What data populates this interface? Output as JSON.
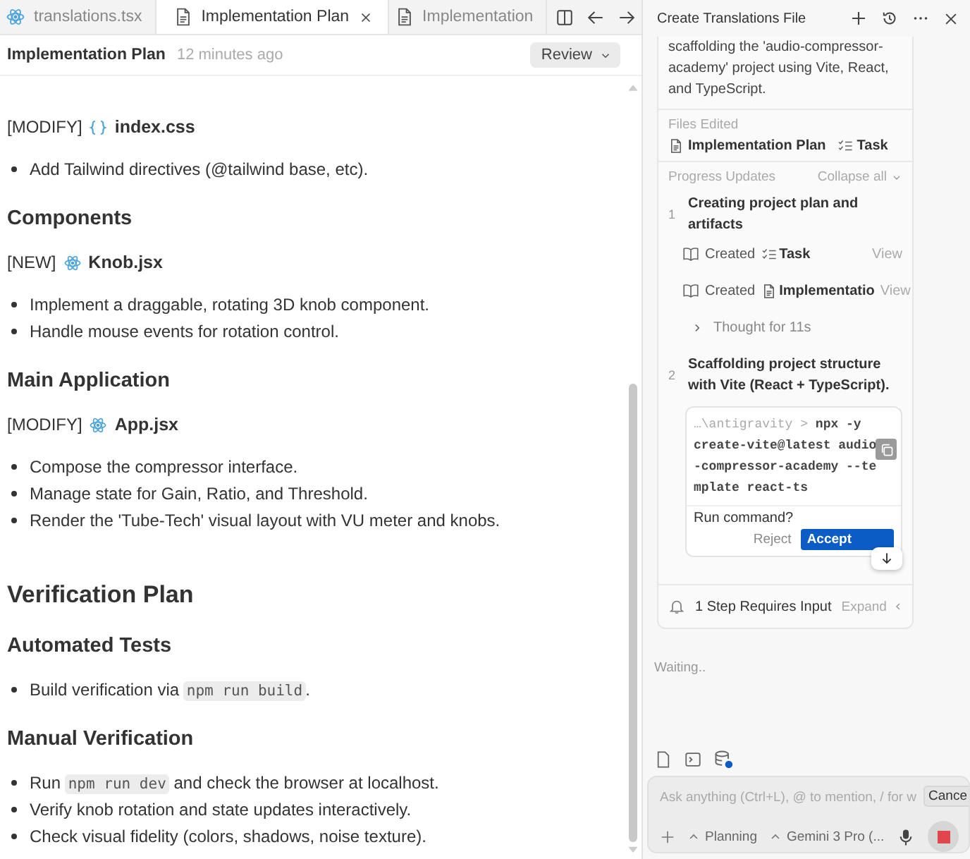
{
  "tabs": [
    {
      "label": "translations.tsx",
      "kind": "component",
      "selected": false
    },
    {
      "label": "Implementation Plan",
      "kind": "document",
      "selected": true
    },
    {
      "label": "Implementation",
      "kind": "document",
      "selected": false
    }
  ],
  "document": {
    "title": "Implementation Plan",
    "time": "12 minutes ago",
    "review_button": "Review",
    "blocks": [
      {
        "kind": "stylesheet",
        "tag": "[MODIFY]",
        "name": "index.css"
      },
      {
        "kind": "bullets",
        "items": [
          [
            {
              "text": "Add Tailwind directives (@tailwind base, etc).",
              "code": false
            }
          ]
        ]
      },
      {
        "kind": "h3",
        "text": "Components"
      },
      {
        "kind": "component",
        "tag": "[NEW]",
        "name": "Knob.jsx"
      },
      {
        "kind": "bullets",
        "items": [
          [
            {
              "text": "Implement a draggable, rotating 3D knob component.",
              "code": false
            }
          ],
          [
            {
              "text": "Handle mouse events for rotation control.",
              "code": false
            }
          ]
        ]
      },
      {
        "kind": "h3",
        "text": "Main Application"
      },
      {
        "kind": "component",
        "tag": "[MODIFY]",
        "name": "App.jsx"
      },
      {
        "kind": "bullets",
        "items": [
          [
            {
              "text": "Compose the compressor interface.",
              "code": false
            }
          ],
          [
            {
              "text": "Manage state for Gain, Ratio, and Threshold.",
              "code": false
            }
          ],
          [
            {
              "text": "Render the 'Tube-Tech' visual layout with VU meter and knobs.",
              "code": false
            }
          ]
        ]
      },
      {
        "kind": "h2",
        "text": "Verification Plan"
      },
      {
        "kind": "h3",
        "text": "Automated Tests"
      },
      {
        "kind": "bullets",
        "items": [
          [
            {
              "text": "Build verification via ",
              "code": false
            },
            {
              "text": "npm run build",
              "code": true
            },
            {
              "text": ".",
              "code": false
            }
          ]
        ]
      },
      {
        "kind": "h3",
        "text": "Manual Verification"
      },
      {
        "kind": "bullets",
        "items": [
          [
            {
              "text": "Run ",
              "code": false
            },
            {
              "text": "npm run dev",
              "code": true
            },
            {
              "text": " and check the browser at localhost.",
              "code": false
            }
          ],
          [
            {
              "text": "Verify knob rotation and state updates interactively.",
              "code": false
            }
          ],
          [
            {
              "text": "Check visual fidelity (colors, shadows, noise texture).",
              "code": false
            }
          ]
        ]
      }
    ]
  },
  "agent": {
    "title": "Create Translations File",
    "summary": "scaffolding the 'audio-compressor-academy' project using Vite, React, and TypeScript.",
    "files_label": "Files Edited",
    "files": [
      {
        "kind": "document",
        "name": "Implementation Plan"
      },
      {
        "kind": "checklist",
        "name": "Task"
      }
    ],
    "progress_label": "Progress Updates",
    "collapse_label": "Collapse all",
    "steps": [
      {
        "number": "1",
        "title": "Creating project plan and artifacts",
        "entries": [
          {
            "kind": "checklist",
            "action": "Created",
            "name": "Task",
            "link": "View"
          },
          {
            "kind": "document",
            "action": "Created",
            "name": "Implementatio",
            "link": "View"
          },
          {
            "kind": "thought",
            "text": "Thought for 11s",
            "expanded": false
          }
        ]
      },
      {
        "number": "2",
        "title": "Scaffolding project structure with Vite (React + TypeScript).",
        "command": {
          "path": "…\\antigravity >",
          "text": "npx -y create-vite@latest audio-compressor-academy --template react-ts",
          "question": "Run command?",
          "reject": "Reject",
          "accept": "Accept"
        }
      }
    ],
    "pending": {
      "text": "1 Step Requires Input",
      "expand_label": "Expand"
    },
    "status": "Waiting..",
    "input": {
      "placeholder": "Ask anything (Ctrl+L), @ to mention, / for w",
      "tooltip": "Cance",
      "mode": "Planning",
      "model": "Gemini 3 Pro (..."
    }
  }
}
